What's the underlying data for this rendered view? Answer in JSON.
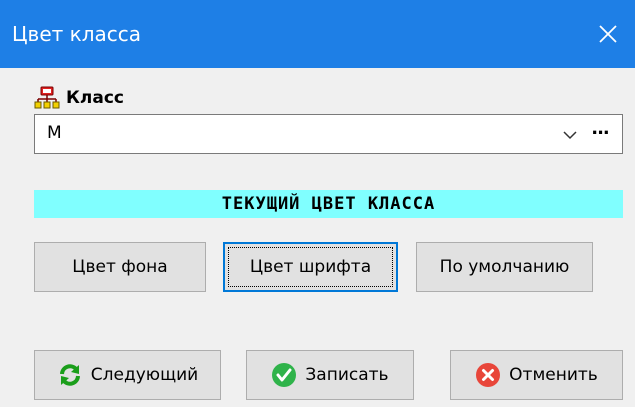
{
  "window": {
    "title": "Цвет класса"
  },
  "class_field": {
    "label": "Класс",
    "value": "М",
    "more_label": "..."
  },
  "current_color": {
    "banner_text": "ТЕКУЩИЙ ЦВЕТ КЛАССА",
    "background": "#80ffff",
    "text_color": "#000000"
  },
  "color_buttons": {
    "background_label": "Цвет фона",
    "font_label": "Цвет шрифта",
    "default_label": "По умолчанию"
  },
  "footer": {
    "next_label": "Следующий",
    "save_label": "Записать",
    "cancel_label": "Отменить"
  },
  "colors": {
    "titlebar": "#1e7fe6",
    "focus": "#0078d7"
  },
  "icons": {
    "close": "close-icon",
    "class": "class-hierarchy-icon",
    "next": "refresh-arrows-icon",
    "save": "check-circle-icon",
    "cancel": "x-circle-icon"
  }
}
